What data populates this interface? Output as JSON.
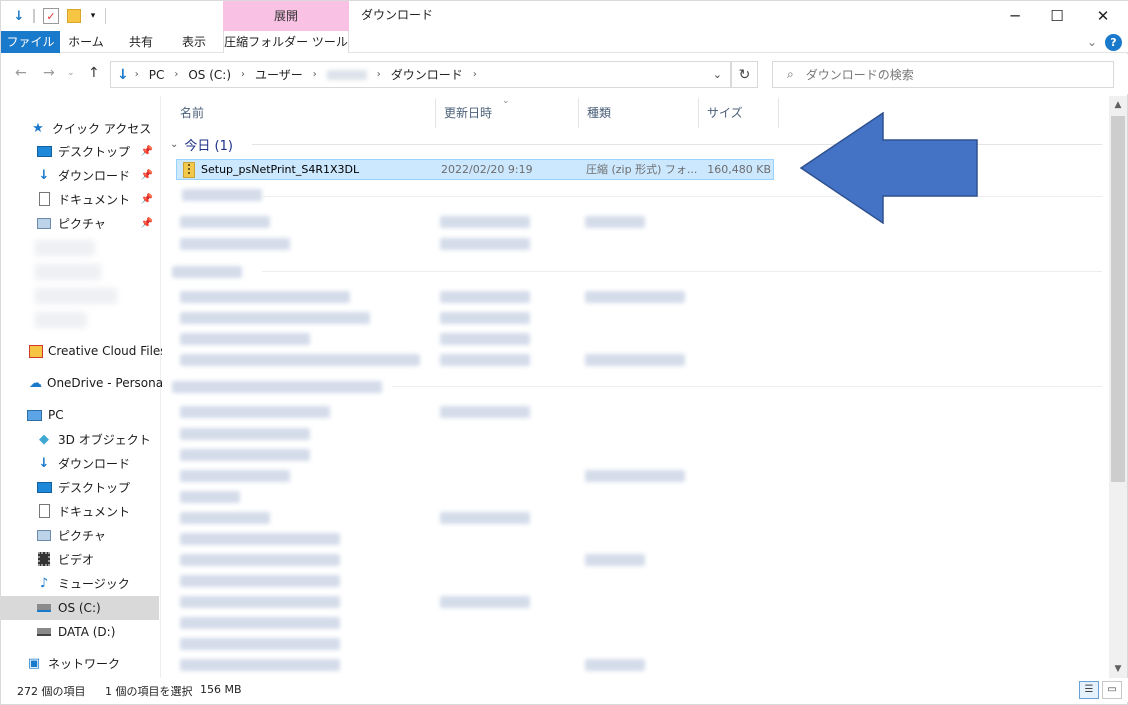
{
  "window": {
    "title": "ダウンロード",
    "context_tab_header": "展開",
    "minimize_icon": "─",
    "maximize_icon": "☐",
    "close_icon": "✕"
  },
  "ribbon": {
    "tabs": [
      "ファイル",
      "ホーム",
      "共有",
      "表示",
      "圧縮フォルダー ツール"
    ],
    "collapse_icon": "⌄",
    "help": "?"
  },
  "address": {
    "crumbs": [
      "PC",
      "OS (C:)",
      "ユーザー",
      "ダウンロード"
    ],
    "search_placeholder": "ダウンロードの検索"
  },
  "sidebar": {
    "items": [
      {
        "label": "クイック アクセス",
        "icon": "star-icon"
      },
      {
        "label": "デスクトップ",
        "icon": "desktop-icon"
      },
      {
        "label": "ダウンロード",
        "icon": "download-icon"
      },
      {
        "label": "ドキュメント",
        "icon": "document-icon"
      },
      {
        "label": "ピクチャ",
        "icon": "picture-icon"
      },
      {
        "label": "Creative Cloud Files",
        "icon": "creative-cloud-icon"
      },
      {
        "label": "OneDrive - Personal",
        "icon": "onedrive-icon"
      },
      {
        "label": "PC",
        "icon": "pc-icon"
      },
      {
        "label": "3D オブジェクト",
        "icon": "cube-icon"
      },
      {
        "label": "ダウンロード",
        "icon": "download-icon"
      },
      {
        "label": "デスクトップ",
        "icon": "desktop-icon"
      },
      {
        "label": "ドキュメント",
        "icon": "document-icon"
      },
      {
        "label": "ピクチャ",
        "icon": "picture-icon"
      },
      {
        "label": "ビデオ",
        "icon": "video-icon"
      },
      {
        "label": "ミュージック",
        "icon": "music-icon"
      },
      {
        "label": "OS (C:)",
        "icon": "drive-icon"
      },
      {
        "label": "DATA (D:)",
        "icon": "drive-icon"
      },
      {
        "label": "ネットワーク",
        "icon": "network-icon"
      }
    ]
  },
  "columns": {
    "name": "名前",
    "date": "更新日時",
    "type": "種類",
    "size": "サイズ"
  },
  "groups": {
    "today": "今日 (1)"
  },
  "selected_file": {
    "name": "Setup_psNetPrint_S4R1X3DL",
    "date": "2022/02/20 9:19",
    "type": "圧縮 (zip 形式) フォ...",
    "size": "160,480 KB"
  },
  "status": {
    "count": "272 個の項目",
    "selection": "1 個の項目を選択",
    "selection_size": "156 MB"
  },
  "colors": {
    "accent": "#1979ca",
    "context_tab": "#f9c2e4",
    "selection": "#cce8ff",
    "arrow": "#4472c4"
  }
}
